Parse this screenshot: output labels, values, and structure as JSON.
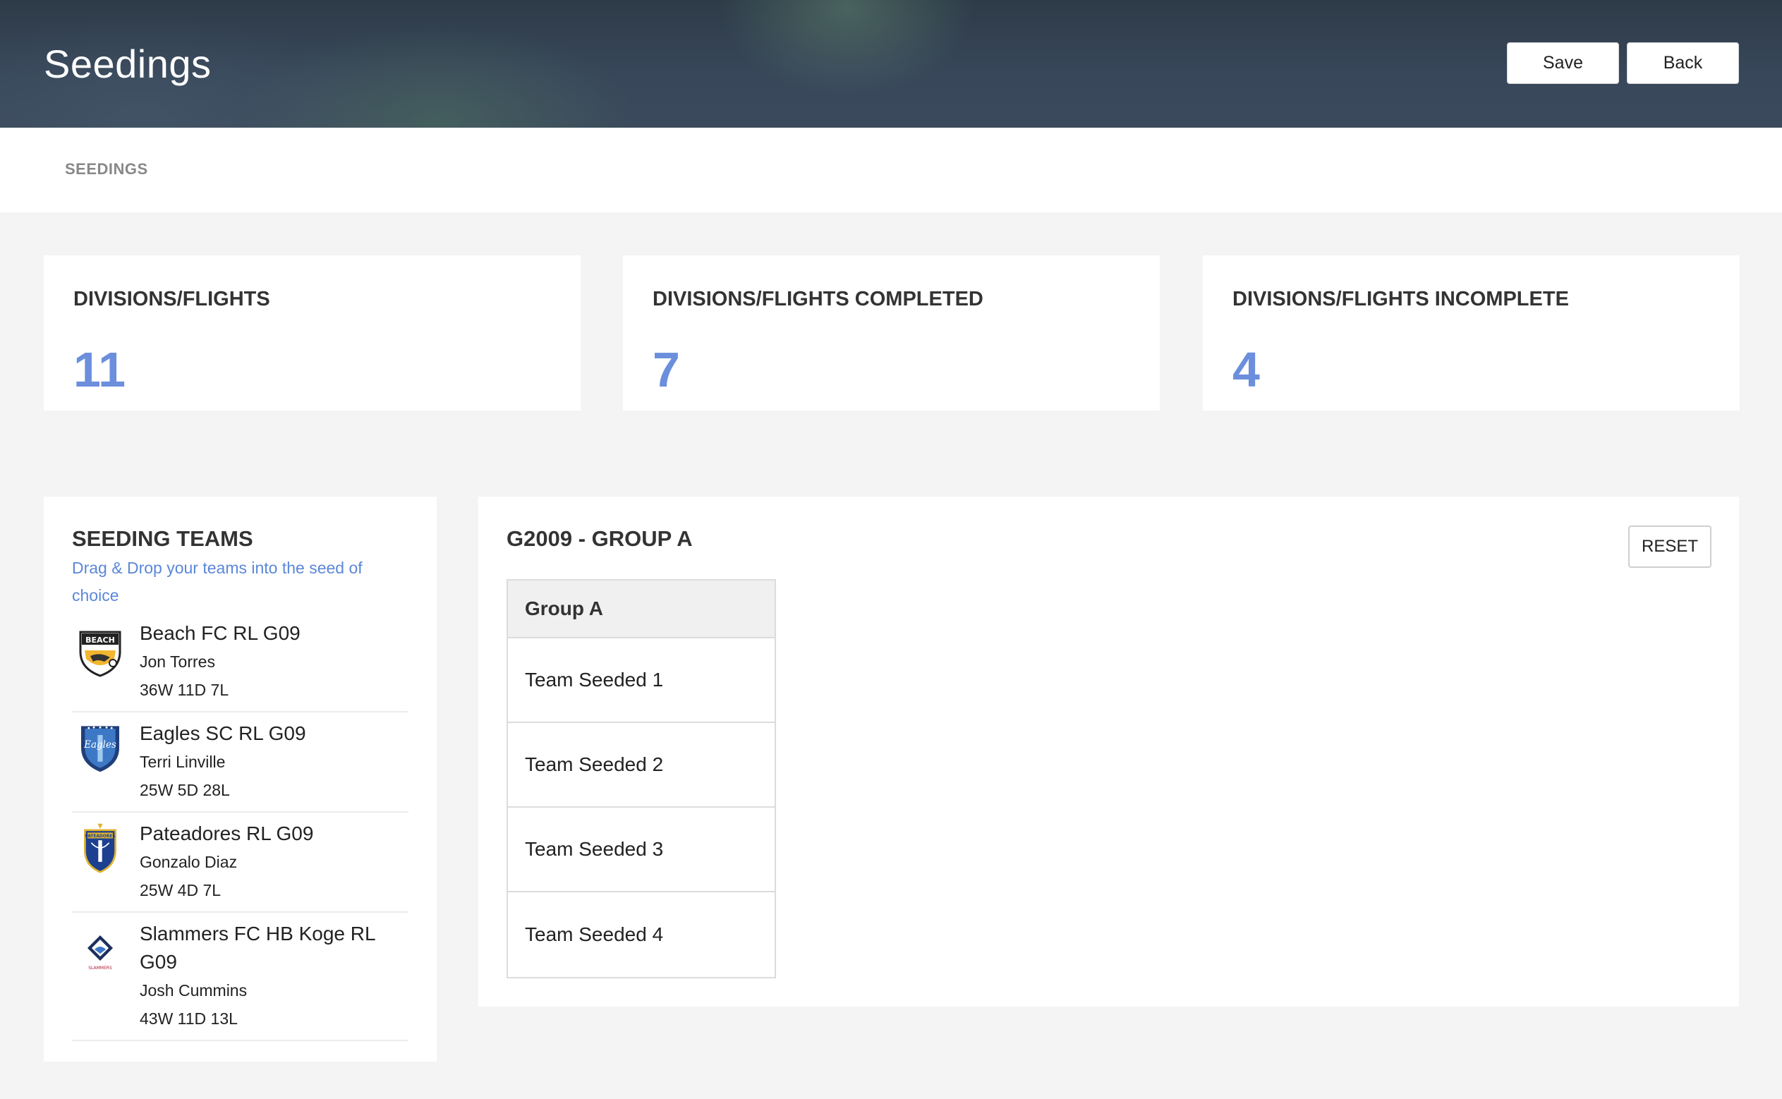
{
  "header": {
    "title": "Seedings",
    "save_label": "Save",
    "back_label": "Back"
  },
  "breadcrumb": "SEEDINGS",
  "stats": [
    {
      "label": "DIVISIONS/FLIGHTS",
      "value": "11"
    },
    {
      "label": "DIVISIONS/FLIGHTS COMPLETED",
      "value": "7"
    },
    {
      "label": "DIVISIONS/FLIGHTS INCOMPLETE",
      "value": "4"
    }
  ],
  "teams_panel": {
    "title": "SEEDING TEAMS",
    "hint": "Drag & Drop your teams into the seed of choice",
    "teams": [
      {
        "name": "Beach FC RL G09",
        "coach": "Jon Torres",
        "record": "36W 11D 7L",
        "logo": "beach-fc-crest",
        "logo_text": "BEACH"
      },
      {
        "name": "Eagles SC RL G09",
        "coach": "Terri Linville",
        "record": "25W 5D 28L",
        "logo": "eagles-sc-crest",
        "logo_text": "Eagles"
      },
      {
        "name": "Pateadores RL G09",
        "coach": "Gonzalo Diaz",
        "record": "25W 4D 7L",
        "logo": "pateadores-crest",
        "logo_text": "PATEADORES"
      },
      {
        "name": "Slammers FC HB Koge RL G09",
        "coach": "Josh Cummins",
        "record": "43W 11D 13L",
        "logo": "slammers-crest",
        "logo_text": "SLAMMERS"
      }
    ]
  },
  "group_panel": {
    "title": "G2009 - GROUP A",
    "reset_label": "RESET",
    "group_name": "Group A",
    "slots": [
      "Team Seeded 1",
      "Team Seeded 2",
      "Team Seeded 3",
      "Team Seeded 4"
    ]
  },
  "colors": {
    "accent_value": "#6b8fdc",
    "hint_link": "#5b87d9",
    "header_bg": "#34424f"
  }
}
